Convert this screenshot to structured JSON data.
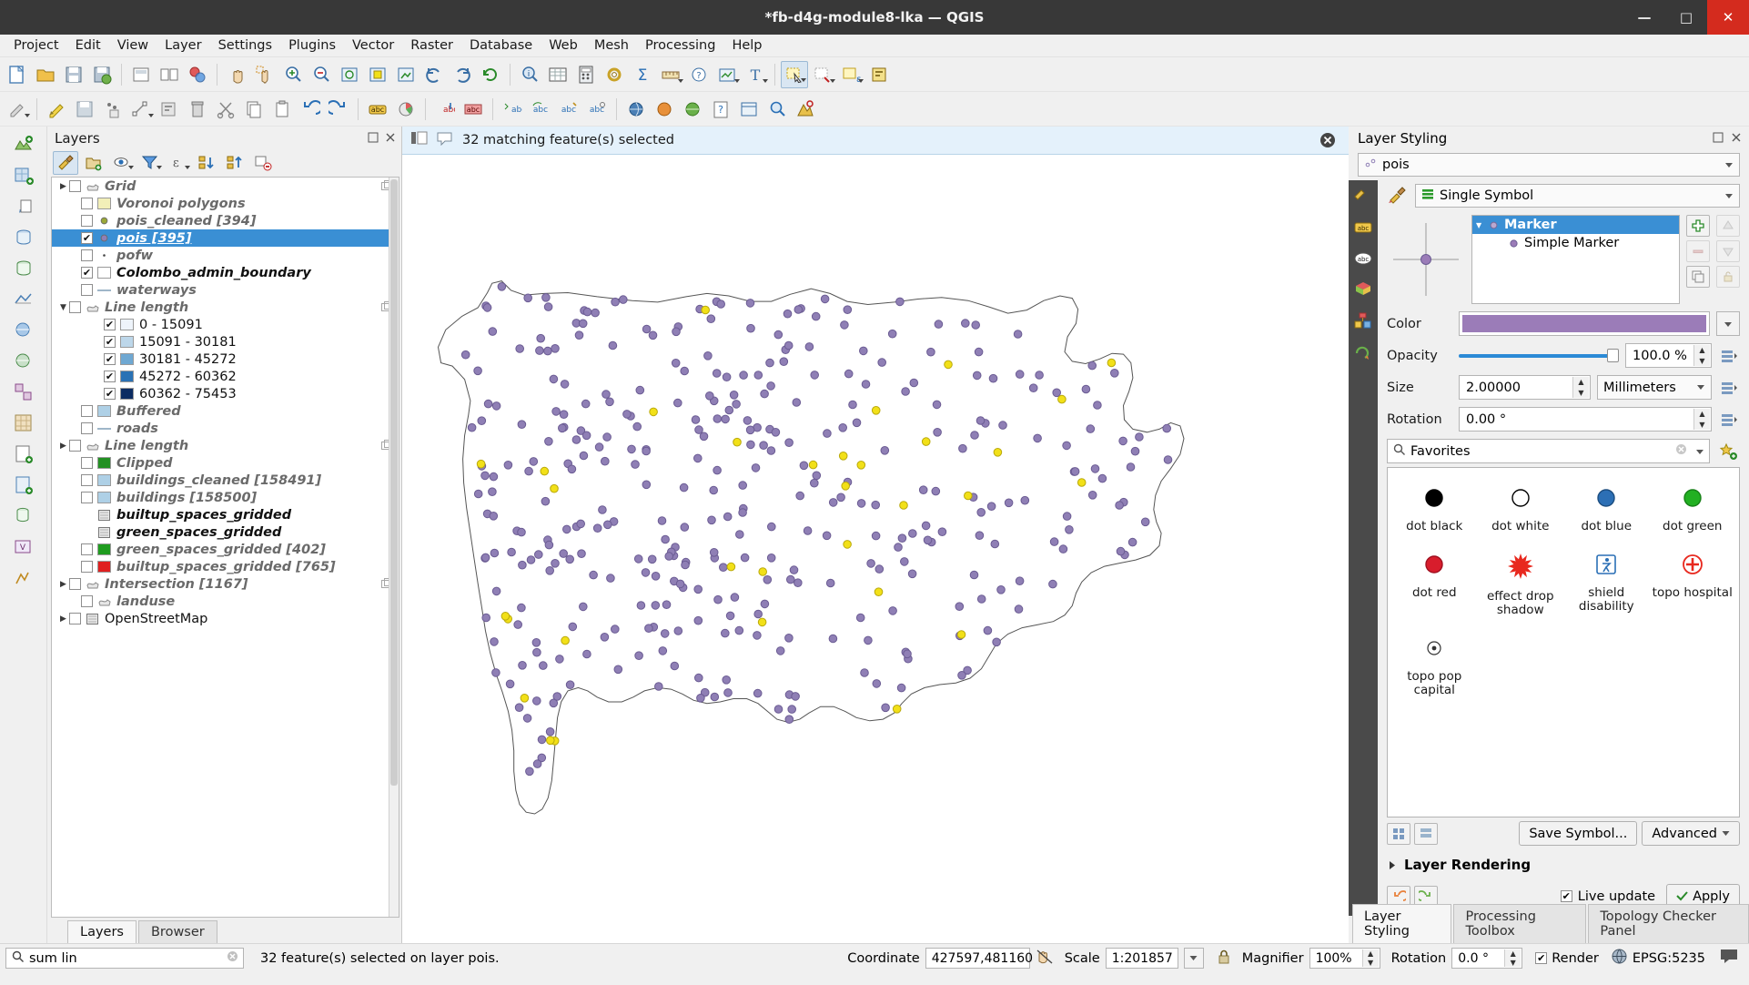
{
  "window": {
    "title": "*fb-d4g-module8-lka — QGIS",
    "minimize": "—",
    "maximize": "□",
    "close": "✕"
  },
  "menubar": [
    "Project",
    "Edit",
    "View",
    "Layer",
    "Settings",
    "Plugins",
    "Vector",
    "Raster",
    "Database",
    "Web",
    "Mesh",
    "Processing",
    "Help"
  ],
  "layers_panel": {
    "title": "Layers",
    "tabs": [
      {
        "label": "Layers",
        "active": true
      },
      {
        "label": "Browser",
        "active": false
      }
    ],
    "items": [
      {
        "name": "Grid",
        "kind": "group",
        "checked": false,
        "twist": "right",
        "indent": 0,
        "style": "italic-bold-grey",
        "icon": "polygon-icon",
        "dup": true
      },
      {
        "name": "Voronoi polygons",
        "kind": "layer",
        "checked": false,
        "indent": 1,
        "style": "italic-bold-grey",
        "icon": "swatch",
        "color": "#f2efb8"
      },
      {
        "name": "pois_cleaned [394]",
        "kind": "layer",
        "checked": false,
        "indent": 1,
        "style": "italic-bold-grey",
        "icon": "dot",
        "color": "#9aa838"
      },
      {
        "name": "pois [395]",
        "kind": "layer",
        "checked": true,
        "indent": 1,
        "style": "selected",
        "icon": "dot",
        "color": "#8f7fb5",
        "selected": true
      },
      {
        "name": "pofw",
        "kind": "layer",
        "checked": false,
        "indent": 1,
        "style": "italic-bold-grey",
        "icon": "tinydot",
        "color": "#555555"
      },
      {
        "name": "Colombo_admin_boundary",
        "kind": "layer",
        "checked": true,
        "indent": 1,
        "style": "bold-black",
        "icon": "swatch",
        "color": "#ffffff"
      },
      {
        "name": "waterways",
        "kind": "layer",
        "checked": false,
        "indent": 1,
        "style": "italic-bold-grey",
        "icon": "line",
        "color": "#9fb6c9"
      },
      {
        "name": "Line length",
        "kind": "group",
        "checked": false,
        "twist": "down",
        "indent": 0,
        "style": "italic-bold-grey",
        "icon": "polygon-icon",
        "dup": true
      },
      {
        "name": "0 - 15091",
        "kind": "class",
        "checked": true,
        "indent": 2,
        "style": "plain",
        "icon": "swatch",
        "color": "#eef4fb"
      },
      {
        "name": "15091 - 30181",
        "kind": "class",
        "checked": true,
        "indent": 2,
        "style": "plain",
        "icon": "swatch",
        "color": "#bdd7ea"
      },
      {
        "name": "30181 - 45272",
        "kind": "class",
        "checked": true,
        "indent": 2,
        "style": "plain",
        "icon": "swatch",
        "color": "#6fa8d2"
      },
      {
        "name": "45272 - 60362",
        "kind": "class",
        "checked": true,
        "indent": 2,
        "style": "plain",
        "icon": "swatch",
        "color": "#2a72b5"
      },
      {
        "name": "60362 - 75453",
        "kind": "class",
        "checked": true,
        "indent": 2,
        "style": "plain",
        "icon": "swatch",
        "color": "#0c2c62"
      },
      {
        "name": "Buffered",
        "kind": "layer",
        "checked": false,
        "indent": 1,
        "style": "italic-bold-grey",
        "icon": "swatch",
        "color": "#aed0e6"
      },
      {
        "name": "roads",
        "kind": "layer",
        "checked": false,
        "indent": 1,
        "style": "italic-bold-grey",
        "icon": "line",
        "color": "#9a9a9a"
      },
      {
        "name": "Line length",
        "kind": "group",
        "checked": false,
        "twist": "right",
        "indent": 0,
        "style": "italic-bold-grey",
        "icon": "polygon-icon",
        "dup": true
      },
      {
        "name": "Clipped",
        "kind": "layer",
        "checked": false,
        "indent": 1,
        "style": "italic-bold-grey",
        "icon": "swatch",
        "color": "#239023"
      },
      {
        "name": "buildings_cleaned [158491]",
        "kind": "layer",
        "checked": false,
        "indent": 1,
        "style": "italic-bold-grey",
        "icon": "swatch",
        "color": "#aed0e6"
      },
      {
        "name": "buildings [158500]",
        "kind": "layer",
        "checked": false,
        "indent": 1,
        "style": "italic-bold-grey",
        "icon": "swatch",
        "color": "#aed0e6"
      },
      {
        "name": "builtup_spaces_gridded",
        "kind": "raster",
        "checked": false,
        "indent": 1,
        "style": "bold-black",
        "icon": "raster",
        "color": "#cccccc",
        "nocheck": true
      },
      {
        "name": "green_spaces_gridded",
        "kind": "raster",
        "checked": false,
        "indent": 1,
        "style": "bold-black",
        "icon": "raster",
        "color": "#cccccc",
        "nocheck": true
      },
      {
        "name": "green_spaces_gridded [402]",
        "kind": "layer",
        "checked": false,
        "indent": 1,
        "style": "italic-bold-grey",
        "icon": "swatch",
        "color": "#1f9c1f"
      },
      {
        "name": "builtup_spaces_gridded [765]",
        "kind": "layer",
        "checked": false,
        "indent": 1,
        "style": "italic-bold-grey",
        "icon": "swatch",
        "color": "#e02020"
      },
      {
        "name": "Intersection [1167]",
        "kind": "group",
        "checked": false,
        "twist": "right",
        "indent": 0,
        "style": "italic-bold-grey",
        "icon": "polygon-icon",
        "dup": true
      },
      {
        "name": "landuse",
        "kind": "layer",
        "checked": false,
        "indent": 1,
        "style": "italic-bold-grey",
        "icon": "polygon-icon",
        "color": "#cccccc"
      },
      {
        "name": "OpenStreetMap",
        "kind": "group",
        "checked": false,
        "twist": "right",
        "indent": 0,
        "style": "plain",
        "icon": "raster",
        "color": "#cccccc"
      }
    ]
  },
  "message_bar": {
    "text": "32 matching feature(s) selected",
    "close_icon": "close-icon"
  },
  "style_panel": {
    "title": "Layer Styling",
    "layer_combo": "pois",
    "renderer_combo": "Single Symbol",
    "symbol_tree": [
      {
        "label": "Marker",
        "selected": true,
        "indent": 0
      },
      {
        "label": "Simple Marker",
        "selected": false,
        "indent": 1
      }
    ],
    "properties": {
      "color_label": "Color",
      "color_value": "#9b7cb8",
      "opacity_label": "Opacity",
      "opacity_value": "100.0 %",
      "size_label": "Size",
      "size_value": "2.00000",
      "size_unit": "Millimeters",
      "rotation_label": "Rotation",
      "rotation_value": "0.00 °"
    },
    "symbol_search": "Favorites",
    "symbols": [
      {
        "label": "dot black",
        "shape": "circle",
        "fill": "#000000",
        "stroke": "#000000"
      },
      {
        "label": "dot white",
        "shape": "circle",
        "fill": "#ffffff",
        "stroke": "#000000"
      },
      {
        "label": "dot blue",
        "shape": "circle",
        "fill": "#2c6fb5",
        "stroke": "#1d4e80"
      },
      {
        "label": "dot green",
        "shape": "circle",
        "fill": "#22b022",
        "stroke": "#178017"
      },
      {
        "label": "dot red",
        "shape": "circle",
        "fill": "#d81d2c",
        "stroke": "#a01020"
      },
      {
        "label": "effect drop shadow",
        "shape": "star",
        "fill": "#e8281e",
        "stroke": "#b01a12"
      },
      {
        "label": "shield disability",
        "shape": "shield",
        "fill": "#ffffff",
        "stroke": "#2a6fb5"
      },
      {
        "label": "topo hospital",
        "shape": "cross-circle",
        "fill": "#ffffff",
        "stroke": "#e8281e"
      },
      {
        "label": "topo pop capital",
        "shape": "dot-circle",
        "fill": "#ffffff",
        "stroke": "#333333"
      }
    ],
    "save_symbol_label": "Save Symbol...",
    "advanced_label": "Advanced",
    "layer_rendering_label": "Layer Rendering",
    "live_update_label": "Live update",
    "live_update_checked": true,
    "apply_label": "Apply",
    "tabs": [
      {
        "label": "Layer Styling",
        "active": true
      },
      {
        "label": "Processing Toolbox",
        "active": false
      },
      {
        "label": "Topology Checker Panel",
        "active": false
      }
    ]
  },
  "statusbar": {
    "search_value": "sum lin",
    "search_clear_icon": "clear-icon",
    "status_text": "32 feature(s) selected on layer pois.",
    "coordinate_label": "Coordinate",
    "coordinate_value": "427597,481160",
    "scale_label": "Scale",
    "scale_value": "1:201857",
    "magnifier_label": "Magnifier",
    "magnifier_value": "100%",
    "rotation_label": "Rotation",
    "rotation_value": "0.0 °",
    "render_label": "Render",
    "render_checked": true,
    "crs_value": "EPSG:5235",
    "messages_icon": "message-icon"
  },
  "map": {
    "boundary_color": "#555555",
    "point_fill": "#8f7fb5",
    "point_stroke": "#6b5c93",
    "selected_fill": "#f2e018",
    "selected_stroke": "#b9a90c"
  }
}
